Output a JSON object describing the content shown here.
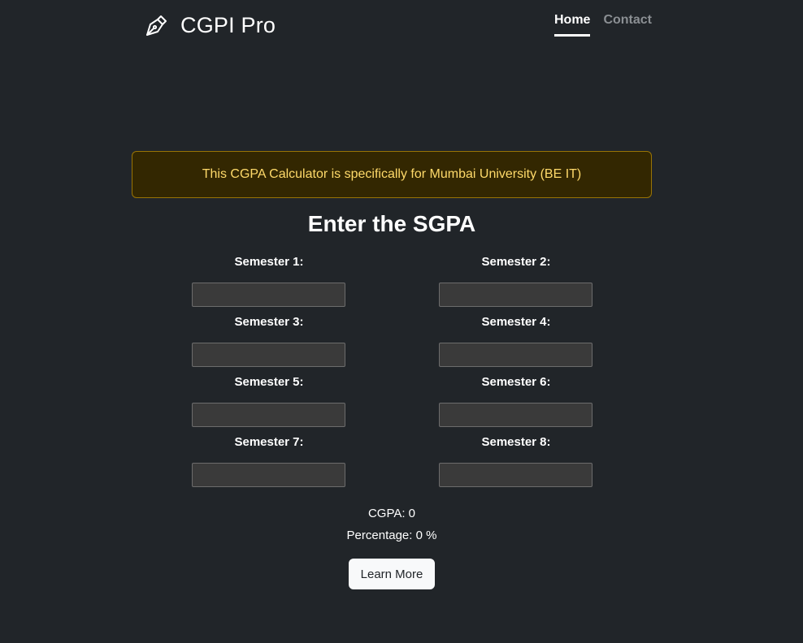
{
  "header": {
    "brand_name": "CGPI Pro",
    "brand_icon": "pen-nib-icon",
    "nav": [
      {
        "label": "Home",
        "active": true
      },
      {
        "label": "Contact",
        "active": false
      }
    ]
  },
  "alert": {
    "text": "This CGPA Calculator is specifically for Mumbai University (BE IT)"
  },
  "main": {
    "heading": "Enter the SGPA",
    "semesters": [
      {
        "label": "Semester 1:",
        "value": ""
      },
      {
        "label": "Semester 2:",
        "value": ""
      },
      {
        "label": "Semester 3:",
        "value": ""
      },
      {
        "label": "Semester 4:",
        "value": ""
      },
      {
        "label": "Semester 5:",
        "value": ""
      },
      {
        "label": "Semester 6:",
        "value": ""
      },
      {
        "label": "Semester 7:",
        "value": ""
      },
      {
        "label": "Semester 8:",
        "value": ""
      }
    ],
    "cgpa_text": "CGPA: 0",
    "percentage_text": "Percentage: 0 %",
    "learn_more_label": "Learn More"
  },
  "colors": {
    "background": "#212529",
    "alert_bg": "#332701",
    "alert_border": "#997404",
    "alert_text": "#ffda6a",
    "input_bg": "#3a3a3a"
  }
}
